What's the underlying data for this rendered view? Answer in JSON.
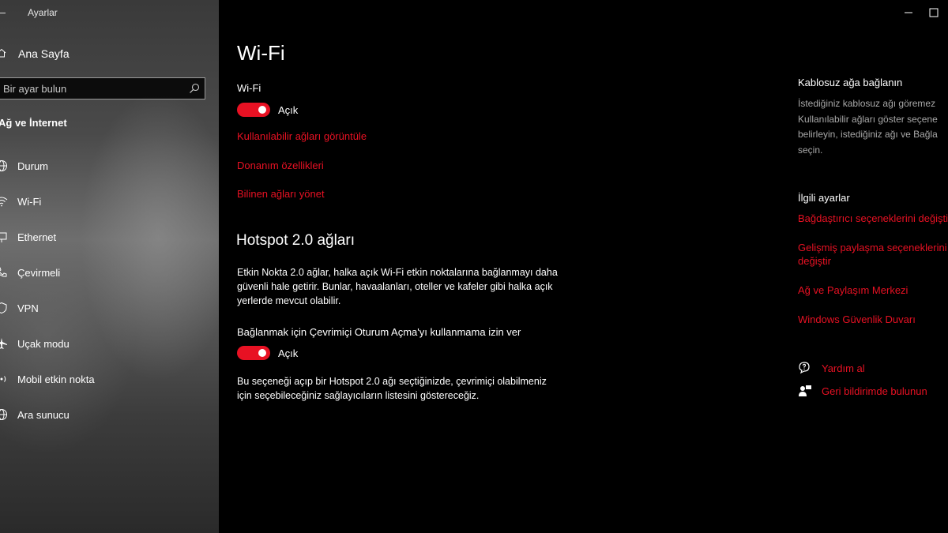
{
  "window": {
    "title": "Ayarlar"
  },
  "sidebar": {
    "home_label": "Ana Sayfa",
    "search_placeholder": "Bir ayar bulun",
    "section_title": "Ağ ve İnternet",
    "items": [
      {
        "label": "Durum",
        "icon": "globe-icon"
      },
      {
        "label": "Wi-Fi",
        "icon": "wifi-icon"
      },
      {
        "label": "Ethernet",
        "icon": "ethernet-icon"
      },
      {
        "label": "Çevirmeli",
        "icon": "phone-icon"
      },
      {
        "label": "VPN",
        "icon": "vpn-icon"
      },
      {
        "label": "Uçak modu",
        "icon": "airplane-icon"
      },
      {
        "label": "Mobil etkin nokta",
        "icon": "hotspot-icon"
      },
      {
        "label": "Ara sunucu",
        "icon": "globe-icon"
      }
    ]
  },
  "main": {
    "title": "Wi-Fi",
    "wifi_label": "Wi-Fi",
    "wifi_toggle": {
      "on": true,
      "label": "Açık"
    },
    "links": [
      "Kullanılabilir ağları görüntüle",
      "Donanım özellikleri",
      "Bilinen ağları yönet"
    ],
    "hotspot_title": "Hotspot 2.0 ağları",
    "hotspot_desc": [
      "Etkin Nokta 2.0 ağlar, halka açık Wi-Fi etkin noktalarına bağlanmayı daha",
      "güvenli hale getirir. Bunlar, havaalanları, oteller ve kafeler gibi halka açık",
      "yerlerde mevcut olabilir."
    ],
    "signin_label": "Bağlanmak için Çevrimiçi Oturum Açma'yı kullanmama izin ver",
    "signin_toggle": {
      "on": true,
      "label": "Açık"
    },
    "signin_desc": [
      "Bu seçeneği açıp bir Hotspot 2.0 ağı seçtiğinizde, çevrimiçi olabilmeniz",
      "için seçebileceğiniz sağlayıcıların listesini göstereceğiz."
    ]
  },
  "right_panel": {
    "connect_title": "Kablosuz ağa bağlanın",
    "connect_text": [
      "İstediğiniz kablosuz ağı göremez",
      "Kullanılabilir ağları göster seçene",
      "belirleyin, istediğiniz ağı ve Bağla",
      "seçin."
    ],
    "related_title": "İlgili ayarlar",
    "related_links": [
      "Bağdaştırıcı seçeneklerini değiştir",
      "Gelişmiş paylaşma seçeneklerini",
      "değiştir",
      "Ağ ve Paylaşım Merkezi",
      "Windows Güvenlik Duvarı"
    ],
    "help_label": "Yardım al",
    "feedback_label": "Geri bildirimde bulunun"
  },
  "colors": {
    "accent": "#e81123",
    "background": "#000000",
    "secondary_text": "#a8a8a8"
  }
}
